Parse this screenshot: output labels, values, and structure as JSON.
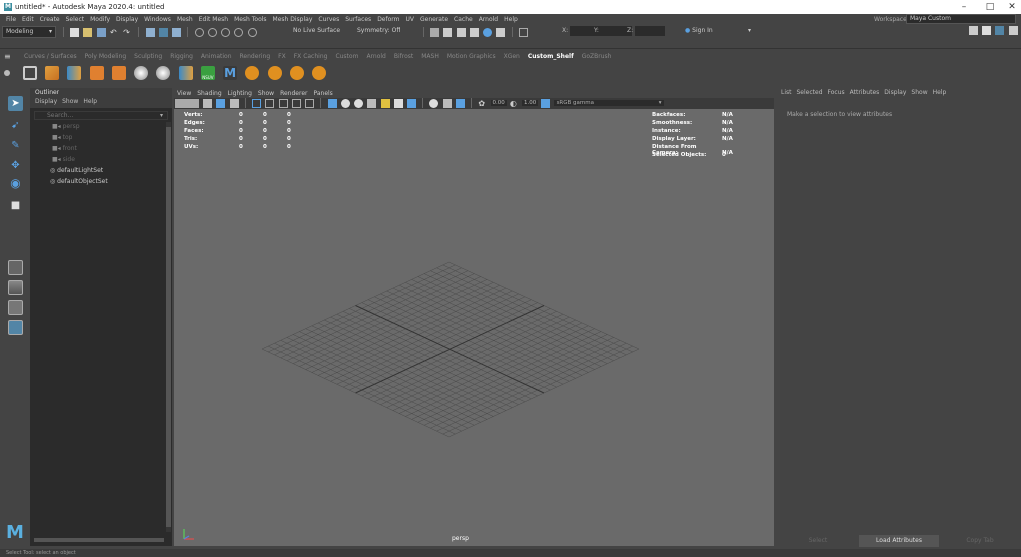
{
  "window": {
    "title": "untitled* - Autodesk Maya 2020.4: untitled",
    "logo_letter": "M",
    "minimize": "–",
    "maximize": "□",
    "close": "✕"
  },
  "menubar": {
    "items": [
      "File",
      "Edit",
      "Create",
      "Select",
      "Modify",
      "Display",
      "Windows",
      "Mesh",
      "Edit Mesh",
      "Mesh Tools",
      "Mesh Display",
      "Curves",
      "Surfaces",
      "Deform",
      "UV",
      "Generate",
      "Cache",
      "Arnold",
      "Help"
    ],
    "workspace_label": "Workspace :",
    "workspace_value": "Maya Custom"
  },
  "statusline": {
    "mode": "Modeling",
    "live_surface": "No Live Surface",
    "symmetry": "Symmetry: Off",
    "x_label": "X:",
    "y_label": "Y:",
    "z_label": "Z:",
    "sign_in": "Sign In"
  },
  "shelf": {
    "tabs": [
      "Curves / Surfaces",
      "Poly Modeling",
      "Sculpting",
      "Rigging",
      "Animation",
      "Rendering",
      "FX",
      "FX Caching",
      "Custom",
      "Arnold",
      "Bifrost",
      "MASH",
      "Motion Graphics",
      "XGen",
      "Custom_Shelf",
      "GoZBrush"
    ],
    "active_tab": "Custom_Shelf",
    "icon_badge": "NSUV"
  },
  "outliner": {
    "title": "Outliner",
    "menus": [
      "Display",
      "Show",
      "Help"
    ],
    "search_placeholder": "Search...",
    "items": [
      "persp",
      "top",
      "front",
      "side",
      "defaultLightSet",
      "defaultObjectSet"
    ]
  },
  "viewport": {
    "menus": [
      "View",
      "Shading",
      "Lighting",
      "Show",
      "Renderer",
      "Panels"
    ],
    "exposure": "0.00",
    "gamma": "1.00",
    "colorspace": "sRGB gamma",
    "camera_label": "persp",
    "hud_left": [
      {
        "label": "Verts:",
        "values": [
          "0",
          "0",
          "0"
        ]
      },
      {
        "label": "Edges:",
        "values": [
          "0",
          "0",
          "0"
        ]
      },
      {
        "label": "Faces:",
        "values": [
          "0",
          "0",
          "0"
        ]
      },
      {
        "label": "Tris:",
        "values": [
          "0",
          "0",
          "0"
        ]
      },
      {
        "label": "UVs:",
        "values": [
          "0",
          "0",
          "0"
        ]
      }
    ],
    "hud_right": [
      {
        "label": "Backfaces:",
        "value": "N/A"
      },
      {
        "label": "Smoothness:",
        "value": "N/A"
      },
      {
        "label": "Instance:",
        "value": "N/A"
      },
      {
        "label": "Display Layer:",
        "value": "N/A"
      },
      {
        "label": "Distance From Camera:",
        "value": "N/A"
      },
      {
        "label": "Selected Objects:",
        "value": "0"
      }
    ]
  },
  "attribute_editor": {
    "menus": [
      "List",
      "Selected",
      "Focus",
      "Attributes",
      "Display",
      "Show",
      "Help"
    ],
    "message": "Make a selection to view attributes",
    "buttons": [
      "Select",
      "Load Attributes",
      "Copy Tab"
    ]
  },
  "helpline": {
    "text": "Select Tool: select an object"
  },
  "colors": {
    "accent": "#5285a6",
    "viewport_bg": "#6a6a6a",
    "panel_bg": "#444444"
  }
}
